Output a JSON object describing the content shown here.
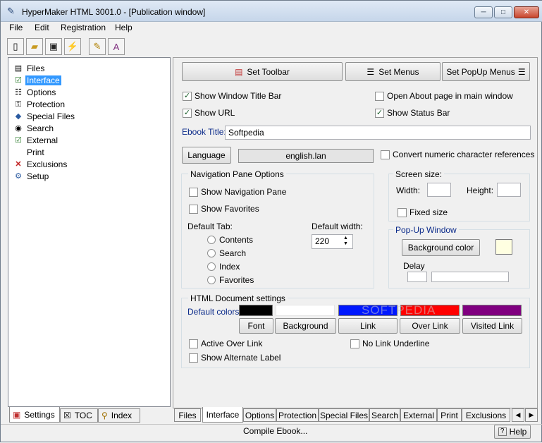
{
  "window": {
    "title": "HyperMaker HTML 3001.0 - [Publication window]"
  },
  "menu": [
    "File",
    "Edit",
    "Registration",
    "Help"
  ],
  "toolbar_icons": [
    "new-icon",
    "open-icon",
    "save-icon",
    "compile-icon",
    "edit-icon",
    "preview-icon"
  ],
  "tree": {
    "items": [
      {
        "label": "Files",
        "icon": "files-icon"
      },
      {
        "label": "Interface",
        "icon": "interface-icon",
        "selected": true
      },
      {
        "label": "Options",
        "icon": "options-icon"
      },
      {
        "label": "Protection",
        "icon": "key-icon"
      },
      {
        "label": "Special Files",
        "icon": "special-files-icon"
      },
      {
        "label": "Search",
        "icon": "binoculars-icon"
      },
      {
        "label": "External",
        "icon": "external-icon"
      },
      {
        "label": "Print",
        "icon": "print-icon"
      },
      {
        "label": "Exclusions",
        "icon": "x-icon"
      },
      {
        "label": "Setup",
        "icon": "setup-icon"
      }
    ]
  },
  "left_tabs": [
    "Settings",
    "TOC",
    "Index"
  ],
  "interface": {
    "set_toolbar": "Set Toolbar",
    "set_menus": "Set Menus",
    "set_popup_menus": "Set PopUp Menus",
    "show_window_title_bar": "Show Window Title Bar",
    "open_about": "Open About page in main window",
    "show_url": "Show URL",
    "show_status_bar": "Show Status Bar",
    "ebook_title_label": "Ebook Title:",
    "ebook_title_value": "Softpedia",
    "language_button": "Language",
    "language_value": "english.lan",
    "convert_numeric": "Convert numeric character references",
    "nav_pane": {
      "title": "Navigation Pane Options",
      "show_nav_pane": "Show Navigation Pane",
      "show_favorites": "Show Favorites",
      "default_tab_label": "Default Tab:",
      "tabs": [
        "Contents",
        "Search",
        "Index",
        "Favorites"
      ],
      "default_width_label": "Default width:",
      "default_width_value": "220"
    },
    "screen_size": {
      "title": "Screen size:",
      "width_label": "Width:",
      "height_label": "Height:",
      "fixed_size": "Fixed size"
    },
    "popup_window": {
      "title": "Pop-Up Window",
      "background_color": "Background color",
      "delay_label": "Delay"
    },
    "html_doc": {
      "title": "HTML Document settings",
      "default_colors_label": "Default colors:",
      "colors": {
        "font": "#000000",
        "background": "#ffffff",
        "link": "#0018ff",
        "over_link": "#ff0000",
        "visited_link": "#800080"
      },
      "buttons": [
        "Font",
        "Background",
        "Link",
        "Over Link",
        "Visited Link"
      ],
      "active_over_link": "Active Over Link",
      "no_link_underline": "No Link Underline",
      "show_alternate_label": "Show Alternate Label"
    }
  },
  "panel_tabs": [
    "Files",
    "Interface",
    "Options",
    "Protection",
    "Special Files",
    "Search",
    "External",
    "Print",
    "Exclusions"
  ],
  "status": {
    "message": "Compile Ebook...",
    "help": "Help"
  },
  "watermark": "SOFTPEDIA"
}
